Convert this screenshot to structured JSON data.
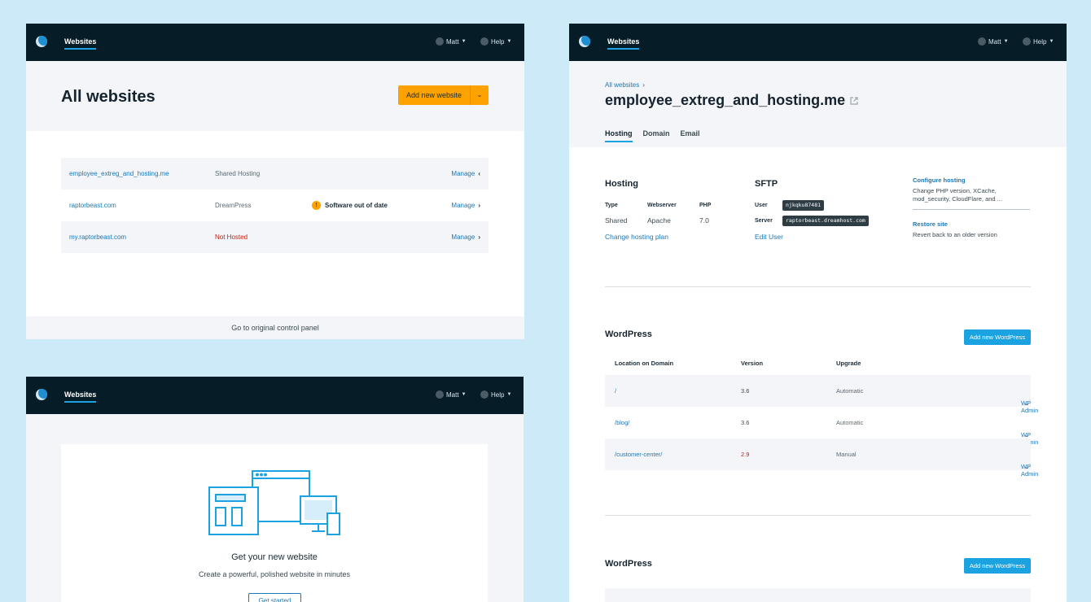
{
  "topbar": {
    "nav_label": "Websites",
    "user_name": "Matt",
    "help_label": "Help"
  },
  "all_websites": {
    "title": "All websites",
    "add_button": "Add new website",
    "sites": [
      {
        "name": "employee_extreg_and_hosting.me",
        "plan": "Shared Hosting",
        "warning": "",
        "action": "Manage"
      },
      {
        "name": "raptorbeast.com",
        "plan": "DreamPress",
        "warning": "Software out of date",
        "action": "Manage"
      },
      {
        "name": "my.raptorbeast.com",
        "plan": "Not Hosted",
        "warning": "",
        "action": "Manage"
      }
    ],
    "footer_link": "Go to original control panel"
  },
  "new_website": {
    "title": "Get your new website",
    "subtitle": "Create a powerful, polished website in minutes",
    "button": "Get started"
  },
  "site_detail": {
    "breadcrumb": "All websites",
    "title": "employee_extreg_and_hosting.me",
    "tabs": [
      "Hosting",
      "Domain",
      "Email"
    ],
    "hosting": {
      "title": "Hosting",
      "type_label": "Type",
      "webserver_label": "Webserver",
      "php_label": "PHP",
      "type_value": "Shared",
      "webserver_value": "Apache",
      "php_value": "7.0",
      "change_link": "Change hosting plan"
    },
    "sftp": {
      "title": "SFTP",
      "user_label": "User",
      "user_value": "njkqku87481",
      "server_label": "Server",
      "server_value": "raptorbeast.dreamhost.com",
      "edit_link": "Edit User"
    },
    "sidebar": {
      "configure_link": "Configure hosting",
      "configure_desc": "Change PHP version, XCache, mod_security, CloudFlare, and ...",
      "restore_link": "Restore site",
      "restore_desc": "Revert back to an older version"
    },
    "wordpress": {
      "title": "WordPress",
      "add_button": "Add new WordPress",
      "columns": [
        "Location on Domain",
        "Version",
        "Upgrade"
      ],
      "rows": [
        {
          "location": "/",
          "version": "3.6",
          "upgrade": "Automatic",
          "action": "WP Admin"
        },
        {
          "location": "/blog/",
          "version": "3.6",
          "upgrade": "Automatic",
          "action": "WP Admin"
        },
        {
          "location": "/customer-center/",
          "version": "2.9",
          "upgrade": "Manual",
          "action": "WP Admin"
        }
      ]
    },
    "wordpress2": {
      "title": "WordPress",
      "add_button": "Add new WordPress"
    }
  },
  "colors": {
    "topbar": "#061c27",
    "accent_blue": "#1aa3e0",
    "link_blue": "#1b77b5",
    "orange": "#fea200",
    "error_red": "#c4210e",
    "background": "#cdeaf9"
  }
}
